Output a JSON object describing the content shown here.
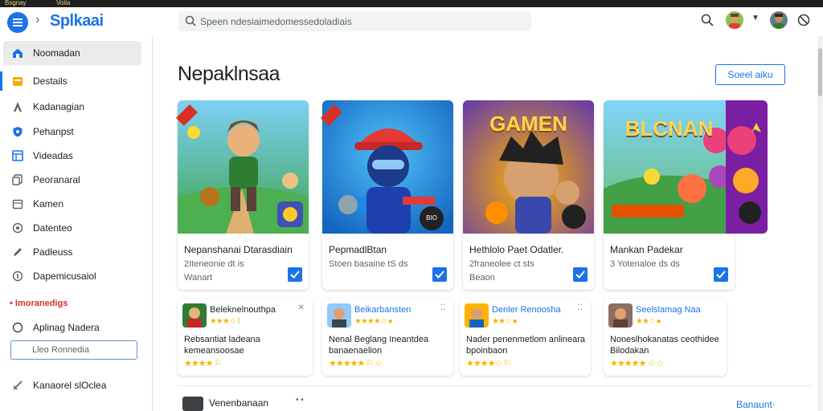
{
  "titlebar": {
    "left_text": "Bsgnay",
    "right_text": "Voila"
  },
  "header": {
    "brand": "Splkaai",
    "search_placeholder": "Speen ndesiaimedomessedoladiais"
  },
  "sidebar": {
    "items": [
      {
        "label": "Noomadan",
        "icon": "home-icon"
      },
      {
        "label": "Destails",
        "icon": "folder-icon"
      },
      {
        "label": "Kadanagian",
        "icon": "person-icon"
      },
      {
        "label": "Pehanpst",
        "icon": "shield-icon"
      },
      {
        "label": "Videadas",
        "icon": "grid-icon"
      },
      {
        "label": "Peoranaral",
        "icon": "copy-icon"
      },
      {
        "label": "Kamen",
        "icon": "calendar-icon"
      },
      {
        "label": "Datenteo",
        "icon": "circle-icon"
      },
      {
        "label": "Padleuss",
        "icon": "pen-icon"
      },
      {
        "label": "Dapemicusaiol",
        "icon": "help-icon"
      }
    ],
    "section_header": "• Imoranedigs",
    "bottom_item": {
      "label": "Aplinag Nadera",
      "icon": "info-icon"
    },
    "input_placeholder": "Lleo Ronnedia",
    "footer_item": {
      "label": "Kanaorel slOclea",
      "icon": "sword-icon"
    }
  },
  "main": {
    "title": "Nepaklnsaa",
    "see_all": "Soeel aiku",
    "cards": [
      {
        "title": "Nepanshanai Dtarasdiain",
        "meta": "2Iteneonie dt is",
        "sub": "Wanart"
      },
      {
        "title": "PepmadlBtan",
        "meta": "Stoen basaine tS ds",
        "sub": ""
      },
      {
        "title": "Hethlolo Paet Odatler.",
        "meta": "2franeolee ct sts",
        "sub": "Beaon"
      },
      {
        "title": "Mankan Padekar",
        "meta": "3 Yotenaloe ds ds",
        "sub": ""
      }
    ],
    "card_badges": [
      "",
      "BIO",
      "",
      ""
    ],
    "card_art_titles": [
      "",
      "",
      "GAMEN",
      "BLCNAN"
    ],
    "mini_cards": [
      {
        "title": "Beleknelnouthpa",
        "stars": "★★★☆ ⌇",
        "desc": "Rebsantiat ladeana kemeansoosae",
        "stars2": "★★★★ ⚐"
      },
      {
        "title": "Beikarbansten",
        "stars": "★★★★☆ ●",
        "desc": "Nenal Beglang Ineantdea banaenaelion",
        "stars2": "★★★★★ ⚐ ☆"
      },
      {
        "title": "Denler Renoosha",
        "stars": "★★☆ ●",
        "desc": "Nader penenmetlom anlineara bpoinbaon",
        "stars2": "★★★★☆ ⚐"
      },
      {
        "title": "Seelslamag Naa",
        "stars": "★★☆ ●",
        "desc": "Noneslhokanatas ceothidee Bilodakan",
        "stars2": "★★★★★ ☆ ☆"
      }
    ],
    "bottom_row": {
      "label": "Venenbanaan",
      "link": "Banaunt·"
    }
  }
}
